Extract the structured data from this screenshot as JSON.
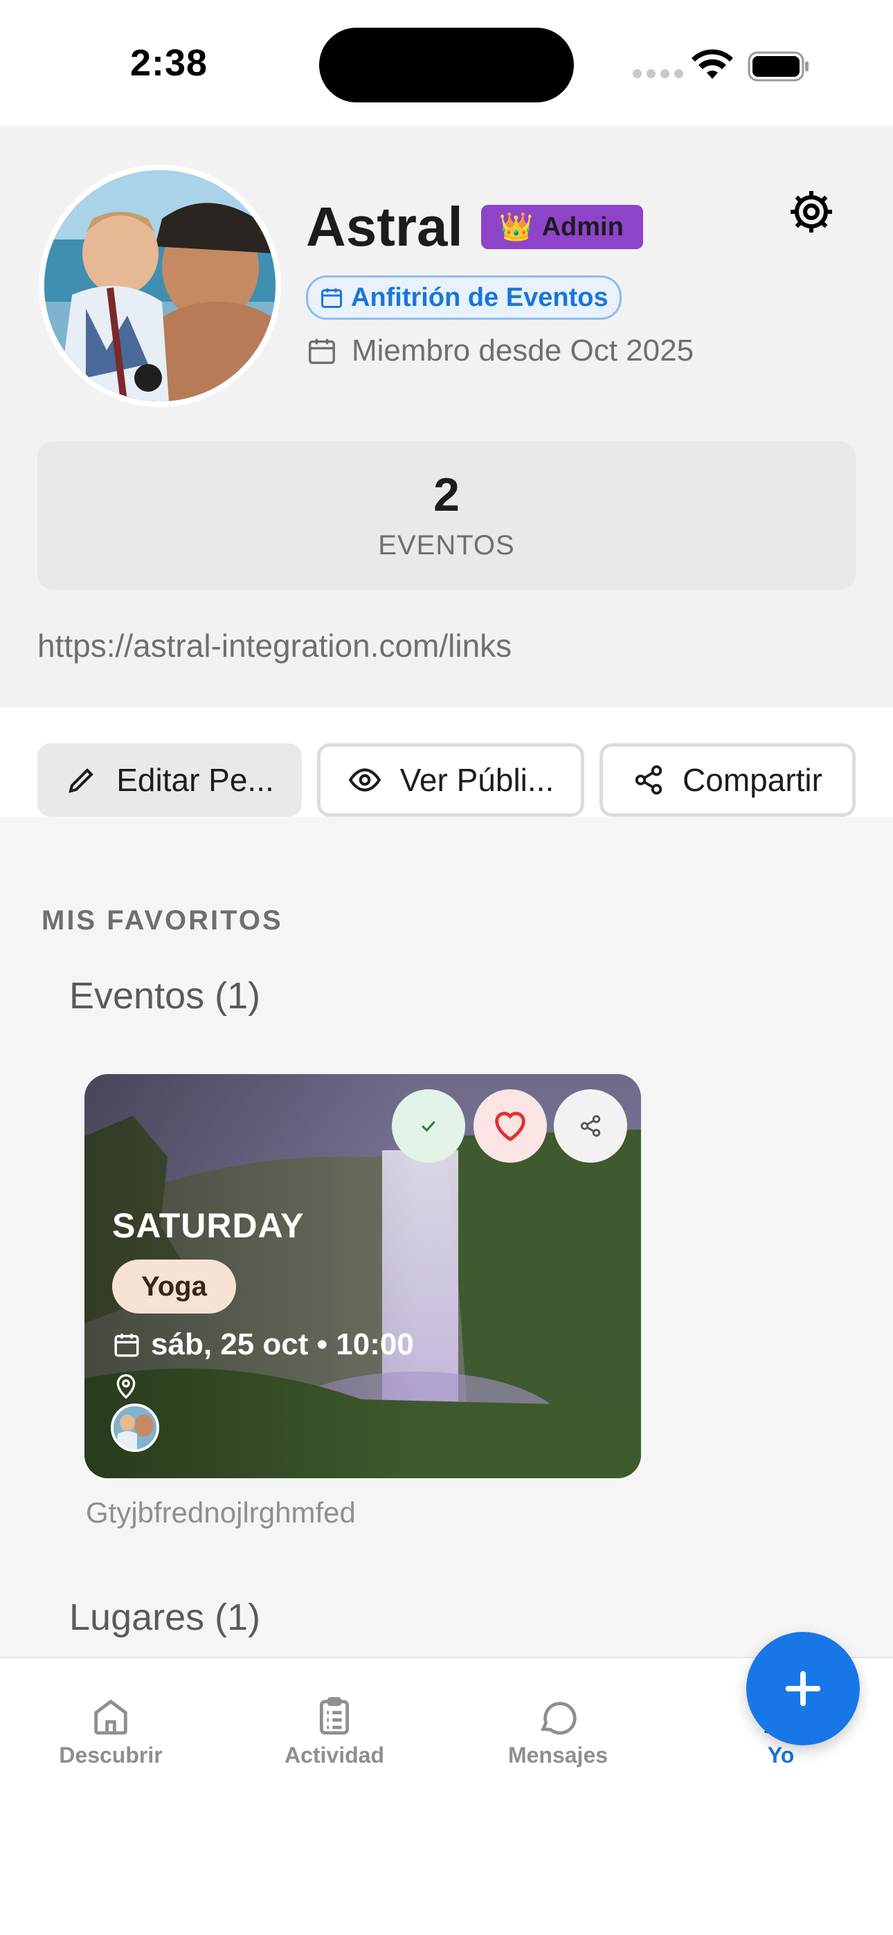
{
  "status_bar": {
    "time": "2:38"
  },
  "profile": {
    "name": "Astral",
    "admin_badge": {
      "emoji": "👑",
      "label": "Admin"
    },
    "host_badge": "Anfitrión de Eventos",
    "member_since": "Miembro desde Oct 2025",
    "stats": {
      "count": "2",
      "label": "EVENTOS"
    },
    "link": "https://astral-integration.com/links"
  },
  "actions": {
    "edit": "Editar Pe...",
    "view_public": "Ver Públi...",
    "share": "Compartir"
  },
  "favorites": {
    "heading": "MIS FAVORITOS",
    "events_heading": "Eventos (1)",
    "places_heading": "Lugares (1)",
    "events": [
      {
        "title": "SATURDAY",
        "tag": "Yoga",
        "datetime": "sáb, 25 oct • 10:00",
        "caption": "Gtyjbfrednojlrghmfed"
      }
    ]
  },
  "nav": {
    "items": [
      {
        "label": "Descubrir",
        "icon": "home-icon"
      },
      {
        "label": "Actividad",
        "icon": "clipboard-icon"
      },
      {
        "label": "Mensajes",
        "icon": "chat-bubble-icon"
      },
      {
        "label": "Yo",
        "icon": "person-icon",
        "active": true
      }
    ]
  },
  "colors": {
    "accent": "#1877D9",
    "admin_badge": "#8E44C9",
    "fab": "#1877E6"
  }
}
